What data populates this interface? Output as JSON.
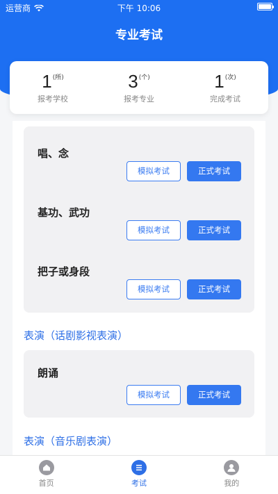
{
  "status_bar": {
    "carrier": "运营商",
    "time": "下午 10:06"
  },
  "header": {
    "title": "专业考试"
  },
  "stats": [
    {
      "value": "1",
      "unit": "(所)",
      "label": "报考学校"
    },
    {
      "value": "3",
      "unit": "(个)",
      "label": "报考专业"
    },
    {
      "value": "1",
      "unit": "(次)",
      "label": "完成考试"
    }
  ],
  "buttons": {
    "mock_label": "模拟考试",
    "formal_label": "正式考试"
  },
  "groups": [
    {
      "items": [
        "唱、念",
        "基功、武功",
        "把子或身段"
      ]
    },
    {
      "title": "表演（话剧影视表演）",
      "items": [
        "朗诵"
      ]
    },
    {
      "title": "表演（音乐剧表演）",
      "items": []
    }
  ],
  "tabbar": {
    "items": [
      {
        "label": "首页",
        "icon": "home-icon"
      },
      {
        "label": "考试",
        "icon": "exam-icon"
      },
      {
        "label": "我的",
        "icon": "user-icon"
      }
    ],
    "active_index": 1
  },
  "colors": {
    "primary": "#1d6ff2",
    "accent": "#3478f0",
    "section_title": "#2e6fe6"
  }
}
